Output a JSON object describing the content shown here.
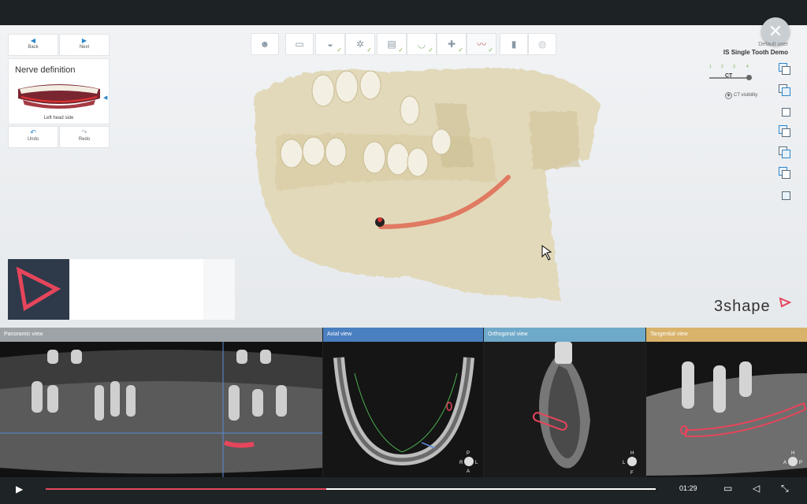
{
  "app": {
    "nav": {
      "back": "Back",
      "next": "Next"
    },
    "panel": {
      "title": "Nerve definition",
      "caption": "Left head side"
    },
    "edit": {
      "undo": "Undo",
      "redo": "Redo"
    },
    "user": "Default user",
    "project": "IS Single Tooth Demo",
    "ct": {
      "label": "CT",
      "visibility": "CT visibility",
      "steps": [
        "1",
        "2",
        "3",
        "4"
      ]
    },
    "brand": "3shape",
    "toolbar_icons": [
      "patient-icon",
      "scan-icon",
      "crown-icon",
      "implant-icon",
      "model-icon",
      "gum-icon",
      "tooth-plus-icon",
      "nerve-icon",
      "implant-post-icon",
      "sphere-icon"
    ],
    "colors": {
      "accent": "#2d86c8",
      "nerve": "#e07a62",
      "brand": "#e6455b",
      "check": "#7cb342"
    }
  },
  "views": [
    {
      "label": "Panoramic view",
      "color": "#9ea3a7"
    },
    {
      "label": "Axial view",
      "color": "#4a7fc0"
    },
    {
      "label": "Orthogonal view",
      "color": "#6fa9c9"
    },
    {
      "label": "Tangential view",
      "color": "#d9b36b"
    }
  ],
  "orientation": {
    "axial": [
      "P",
      "R",
      "L",
      "A"
    ],
    "orthogonal": [
      "H",
      "L",
      "F"
    ],
    "tangential": [
      "H",
      "A",
      "P"
    ]
  },
  "player": {
    "time": "01:29",
    "progress": 0.46
  }
}
